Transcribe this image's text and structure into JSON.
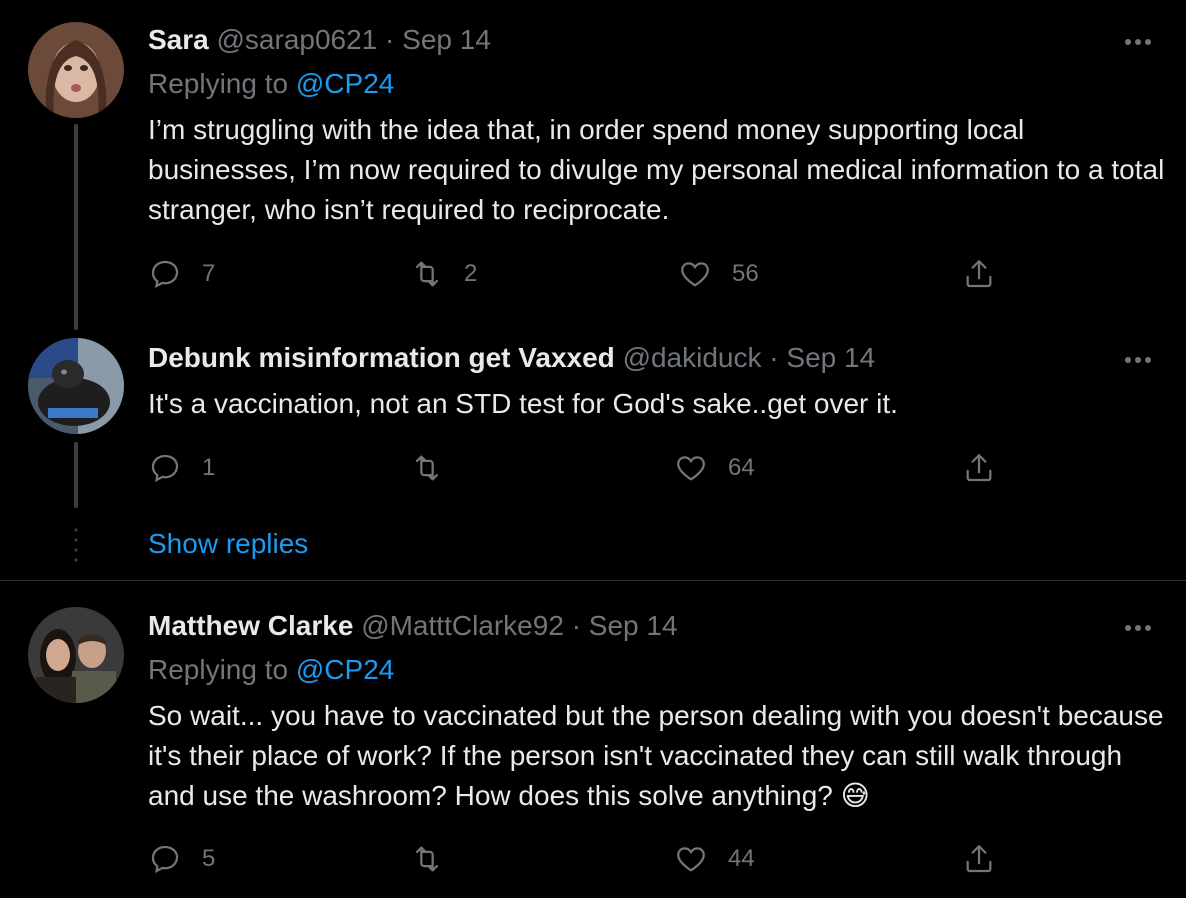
{
  "tweets": [
    {
      "display_name": "Sara",
      "handle": "@sarap0621",
      "date": "Sep 14",
      "replying_prefix": "Replying to",
      "replying_to": "@CP24",
      "text": "I’m struggling with the idea that, in order spend money supporting local businesses, I’m now required to divulge my personal medical information to a total stranger, who isn’t required to reciprocate.",
      "replies": "7",
      "retweets": "2",
      "likes": "56"
    },
    {
      "display_name": "Debunk misinformation get Vaxxed",
      "handle": "@dakiduck",
      "date": "Sep 14",
      "text": "It's a vaccination,  not an STD test for God's sake..get over it.",
      "replies": "1",
      "retweets": "",
      "likes": "64"
    },
    {
      "display_name": "Matthew Clarke",
      "handle": "@MatttClarke92",
      "date": "Sep 14",
      "replying_prefix": "Replying to",
      "replying_to": "@CP24",
      "text": "So wait... you have to vaccinated but the person dealing with you doesn't because it's their place of work? If the person isn't vaccinated they can still walk through and use the washroom? How does this solve anything?",
      "emoji": "😅",
      "replies": "5",
      "retweets": "",
      "likes": "44"
    }
  ],
  "show_replies_label": "Show replies",
  "separator": "·",
  "colors": {
    "background": "#000000",
    "text": "#e7e9ea",
    "muted": "#71767b",
    "accent": "#1d9bf0",
    "divider": "#2f3336"
  },
  "icons": [
    "reply-icon",
    "retweet-icon",
    "like-icon",
    "share-icon",
    "more-icon"
  ]
}
